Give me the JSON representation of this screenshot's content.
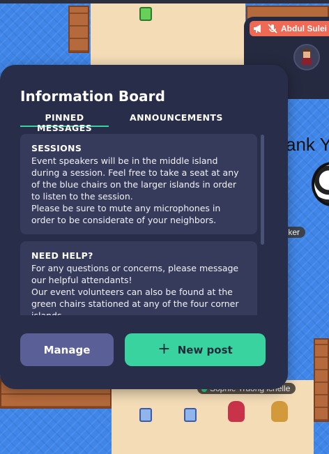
{
  "panel": {
    "title": "Information Board",
    "tabs": [
      {
        "label": "PINNED MESSAGES",
        "active": true
      },
      {
        "label": "ANNOUNCEMENTS",
        "active": false
      }
    ],
    "messages": [
      {
        "title": "SESSIONS",
        "body": "Event speakers will be in the middle island during a session. Feel free to take a seat at any of the blue chairs on the larger islands in order to listen to the session.\nPlease be sure to mute any microphones in order to be considerate of your neighbors."
      },
      {
        "title": "NEED HELP?",
        "body": "For any questions or concerns, please message our helpful attendants!\nOur event volunteers can also be found at the green chairs stationed at any of the four corner islands."
      }
    ],
    "buttons": {
      "manage": "Manage",
      "new_post": "New post"
    }
  },
  "map": {
    "sign_text": "ank Y",
    "labels": {
      "speaker": "alker",
      "participants": "Sophie Truong  ichelle"
    }
  },
  "participant": {
    "name": "Abdul Sulei"
  },
  "colors": {
    "panel_bg": "#282d4a",
    "card_bg": "#363b5c",
    "accent": "#39d3a0",
    "manage_bg": "#5a5f97",
    "name_badge": "#ef6a55"
  },
  "icons": [
    "megaphone-icon",
    "mic-muted-icon",
    "plus-icon"
  ]
}
